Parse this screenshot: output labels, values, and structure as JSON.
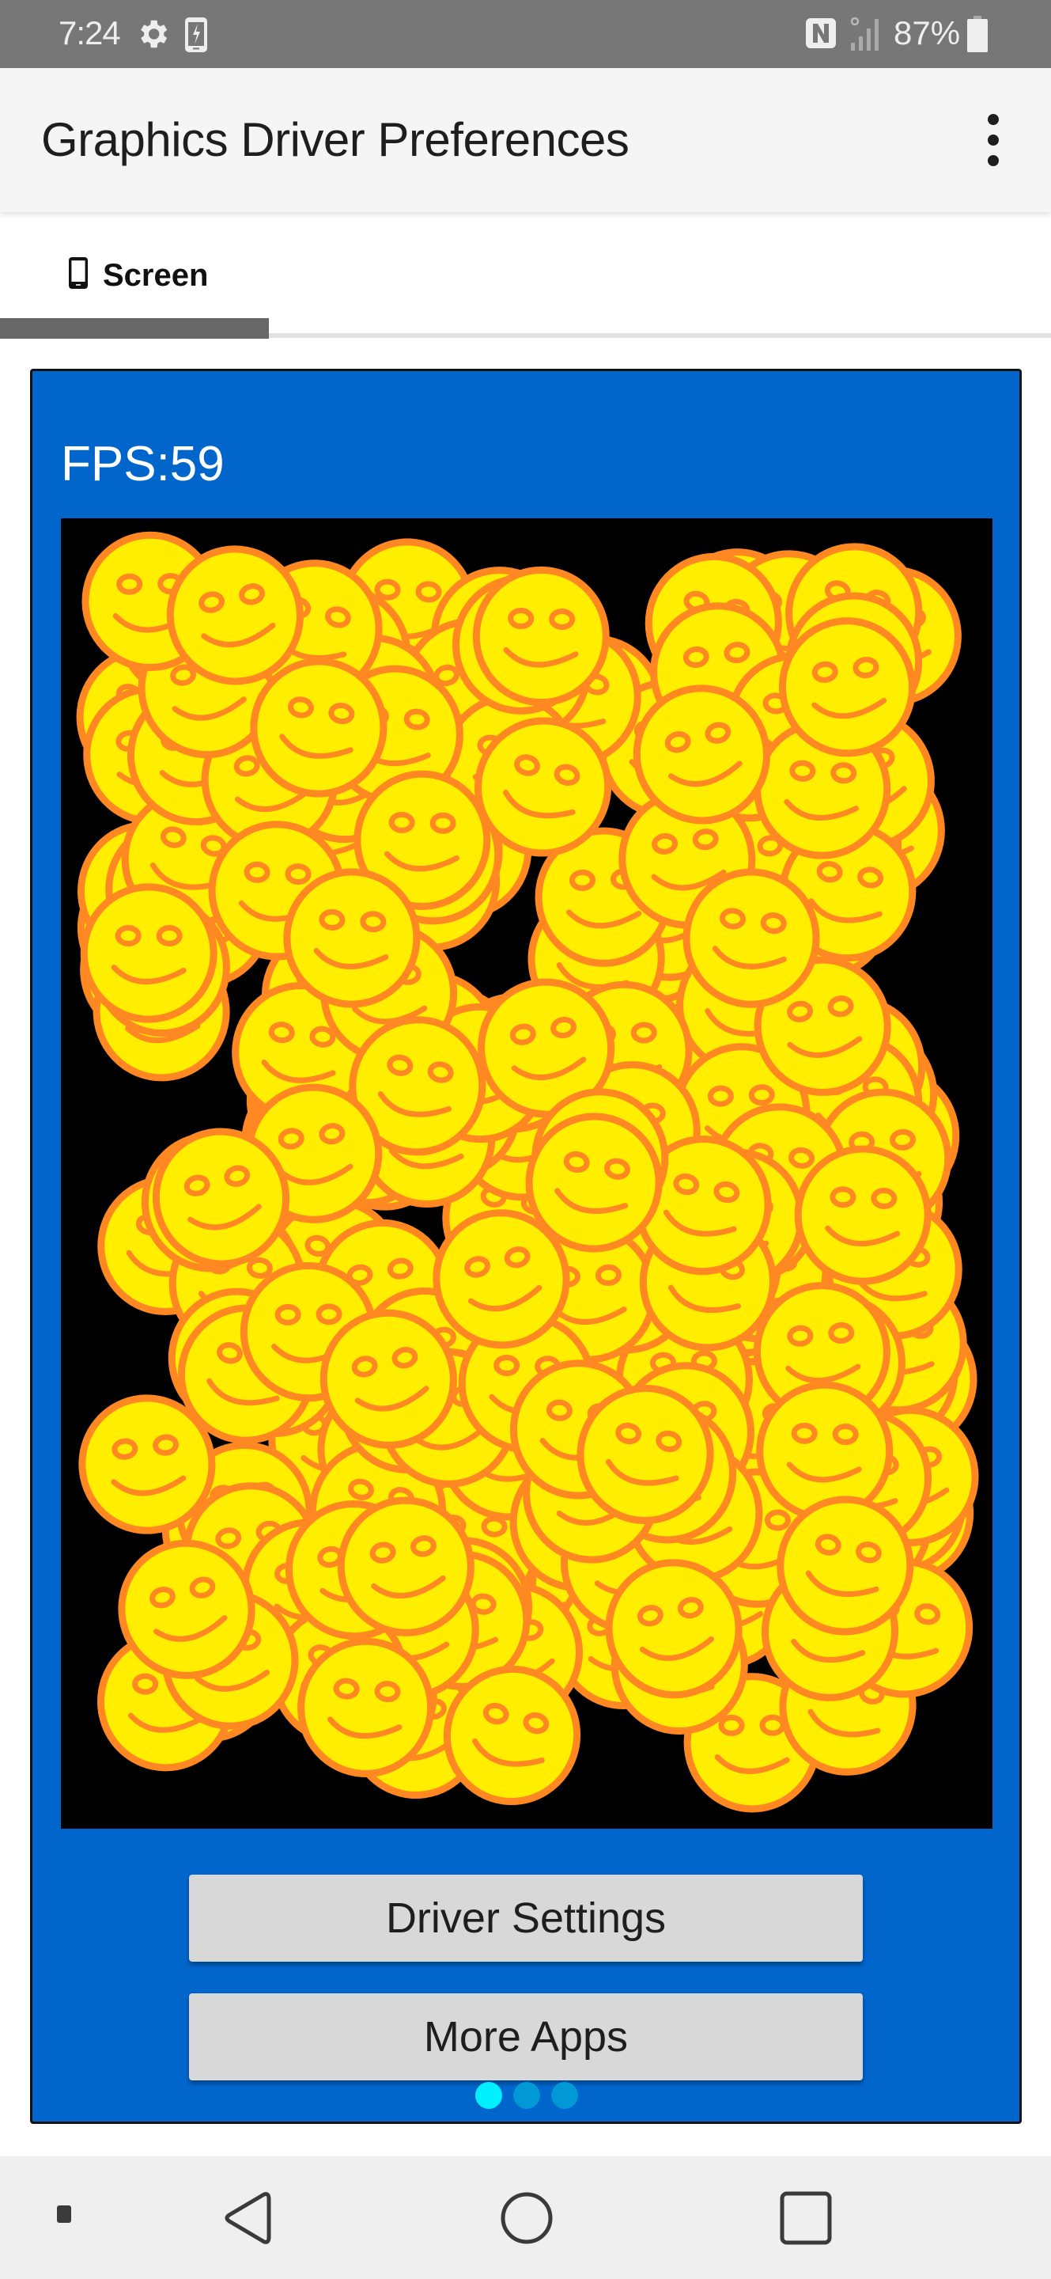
{
  "status_bar": {
    "time": "7:24",
    "left_icons": [
      "settings-gear-icon",
      "phone-charging-icon"
    ],
    "right_icons": [
      "nfc-icon",
      "signal-icon",
      "battery-icon"
    ],
    "battery_percent": "87%",
    "battery_level": 0.87
  },
  "app_bar": {
    "title": "Graphics Driver Preferences",
    "overflow_icon": "more-vert-icon"
  },
  "tabs": [
    {
      "label": "Screen",
      "icon": "smartphone-icon",
      "selected": true
    }
  ],
  "main": {
    "fps_label": "FPS:59",
    "canvas": {
      "description": "Animated benchmark canvas of overlapping smiley faces",
      "sprite": "smiley-face",
      "background_color": "#000000",
      "fill_color": "#ffee00",
      "stroke_color": "#ff8822"
    },
    "buttons": {
      "driver_settings": "Driver Settings",
      "more_apps": "More Apps"
    },
    "page_indicator": {
      "count": 3,
      "active_index": 0,
      "active_color": "#00f0ff",
      "inactive_color": "#0099d6"
    }
  },
  "nav_bar": {
    "items": [
      "menu-dot-icon",
      "back-icon",
      "home-icon",
      "recents-icon"
    ]
  },
  "colors": {
    "status_bar_bg": "#777777",
    "app_bar_bg": "#f5f5f5",
    "card_bg": "#0066cc",
    "button_bg": "#d8d8d8",
    "tab_indicator": "#676767",
    "nav_bar_bg": "#efefef"
  }
}
